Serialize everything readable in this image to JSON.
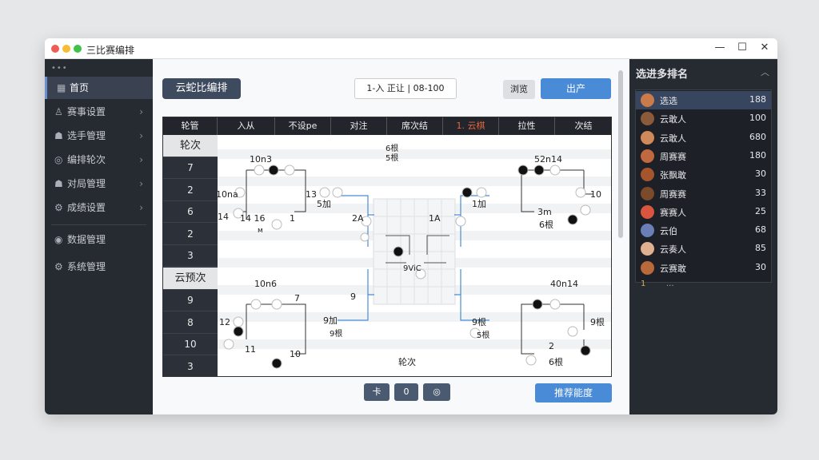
{
  "window": {
    "title": "三比赛编排"
  },
  "sidebar": {
    "dots": "•••",
    "items": [
      {
        "label": "首页",
        "icon": "dashboard-icon",
        "glyph": "▦",
        "active": true,
        "chevron": false
      },
      {
        "label": "赛事设置",
        "icon": "trophy-icon",
        "glyph": "♙",
        "active": false,
        "chevron": true
      },
      {
        "label": "选手管理",
        "icon": "users-icon",
        "glyph": "☗",
        "active": false,
        "chevron": true
      },
      {
        "label": "编排轮次",
        "icon": "shield-icon",
        "glyph": "◎",
        "active": false,
        "chevron": true
      },
      {
        "label": "对局管理",
        "icon": "user-icon",
        "glyph": "☗",
        "active": false,
        "chevron": true
      },
      {
        "label": "成绩设置",
        "icon": "settings-icon",
        "glyph": "⚙",
        "active": false,
        "chevron": true
      },
      {
        "label": "数据管理",
        "icon": "data-icon",
        "glyph": "◉",
        "active": false,
        "chevron": false
      },
      {
        "label": "系统管理",
        "icon": "gear-icon",
        "glyph": "⚙",
        "active": false,
        "chevron": false
      }
    ]
  },
  "toolbar": {
    "title_button": "云蛇比编排",
    "round_info": "1-入  正让 | 08-100",
    "gray_button": "浏览",
    "blue_button": "出产"
  },
  "board": {
    "headers": [
      "轮管",
      "入从",
      "不设pe",
      "对注",
      "席次结",
      "1. 云棋",
      "拉性",
      "次结"
    ],
    "highlight_header": 5,
    "left_cells": [
      "轮次",
      "7",
      "2",
      "6",
      "2",
      "3",
      "云预次",
      "9",
      "8",
      "10",
      "3"
    ],
    "label_cells": [
      0,
      6
    ],
    "tl": {
      "top": "10n3",
      "left": "10na",
      "r": "13",
      "sub": "5加",
      "bl": "14 16",
      "br": "1",
      "mark": "14",
      "foot": "ᴍ"
    },
    "tr": {
      "top": "52n14",
      "right": "10",
      "l": "1加",
      "bot": "3m",
      "bot2": "6根"
    },
    "bl": {
      "top": "10n6",
      "mid": "7",
      "left": "12",
      "r": "9加",
      "sub": "9根",
      "bot": "11",
      "bot2": "10"
    },
    "br": {
      "top": "40n14",
      "right": "9根",
      "l": "9根",
      "sub": "5根",
      "bot": "2",
      "bot2": "6根"
    },
    "center": {
      "top_mark": "6根",
      "top_sub": "5根",
      "l1": "2A",
      "r1": "1A",
      "mid": "9ViC",
      "left9": "9",
      "footer": "轮次"
    }
  },
  "bottom": {
    "b1": "卡",
    "b2": "0",
    "b3": "◎",
    "next_button": "推荐能度"
  },
  "ranking": {
    "title": "选进多排名",
    "players": [
      {
        "name": "选选",
        "score": "188",
        "color": "#c97b4a"
      },
      {
        "name": "云敢人",
        "score": "100",
        "color": "#8a5a3a"
      },
      {
        "name": "云敢人",
        "score": "680",
        "color": "#d08a5a"
      },
      {
        "name": "周赛赛",
        "score": "180",
        "color": "#c2683f"
      },
      {
        "name": "张飘敢",
        "score": "30",
        "color": "#a5552c"
      },
      {
        "name": "周赛赛",
        "score": "33",
        "color": "#7a4a2a"
      },
      {
        "name": "赛赛人",
        "score": "25",
        "color": "#d9553f"
      },
      {
        "name": "云伯",
        "score": "68",
        "color": "#6a7fb8"
      },
      {
        "name": "云奏人",
        "score": "85",
        "color": "#e0b090"
      },
      {
        "name": "云赛敢",
        "score": "30",
        "color": "#b86a3a"
      }
    ],
    "foot_num": "1",
    "foot_text": "..."
  }
}
